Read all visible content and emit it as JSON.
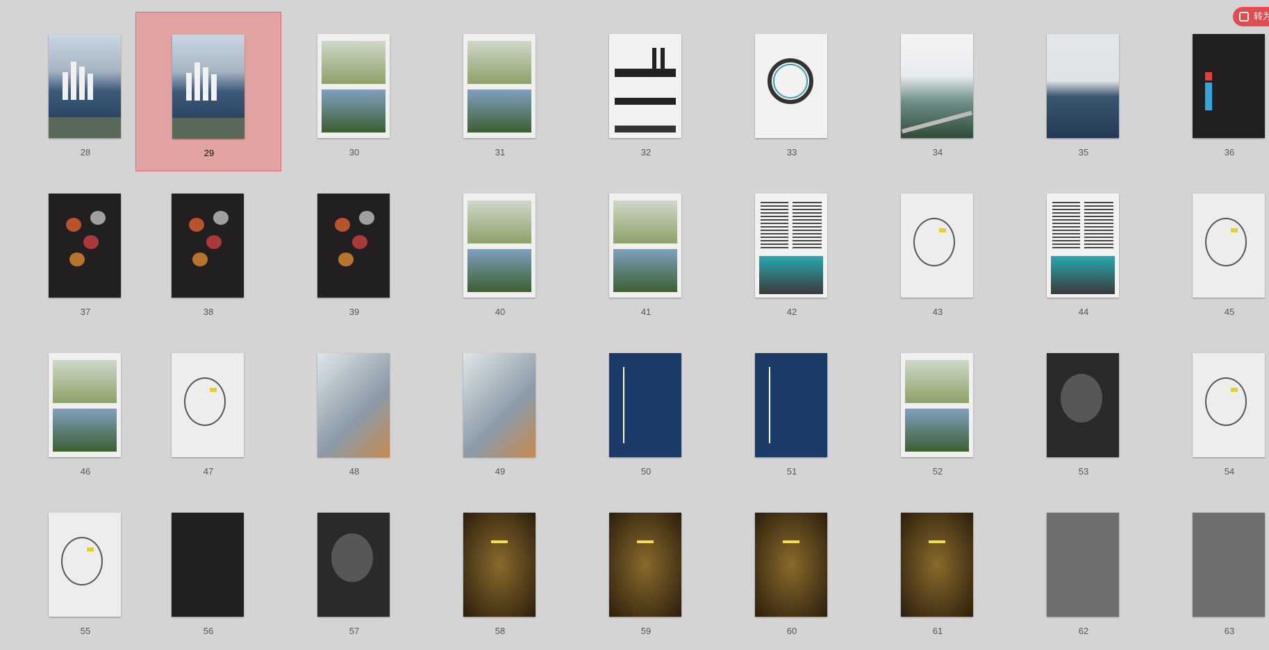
{
  "toolbar": {
    "convert_label": "转为",
    "convert_icon": "convert-icon"
  },
  "selected_page": "29",
  "pages": [
    {
      "label": "28",
      "art": "photo"
    },
    {
      "label": "29",
      "art": "photo"
    },
    {
      "label": "30",
      "art": "two"
    },
    {
      "label": "31",
      "art": "two"
    },
    {
      "label": "32",
      "art": "diagram"
    },
    {
      "label": "33",
      "art": "ring"
    },
    {
      "label": "34",
      "art": "bridge"
    },
    {
      "label": "35",
      "art": "river"
    },
    {
      "label": "36",
      "art": "darktext"
    },
    {
      "label": "37",
      "art": "darkmap"
    },
    {
      "label": "38",
      "art": "darkmap"
    },
    {
      "label": "39",
      "art": "darkmap"
    },
    {
      "label": "40",
      "art": "two"
    },
    {
      "label": "41",
      "art": "two"
    },
    {
      "label": "42",
      "art": "text"
    },
    {
      "label": "43",
      "art": "map"
    },
    {
      "label": "44",
      "art": "text"
    },
    {
      "label": "45",
      "art": "map"
    },
    {
      "label": "46",
      "art": "two"
    },
    {
      "label": "47",
      "art": "map"
    },
    {
      "label": "48",
      "art": "aerial"
    },
    {
      "label": "49",
      "art": "aerial"
    },
    {
      "label": "50",
      "art": "blue"
    },
    {
      "label": "51",
      "art": "blue"
    },
    {
      "label": "52",
      "art": "two"
    },
    {
      "label": "53",
      "art": "bw"
    },
    {
      "label": "54",
      "art": "map"
    },
    {
      "label": "55",
      "art": "map"
    },
    {
      "label": "56",
      "art": "dark"
    },
    {
      "label": "57",
      "art": "bw"
    },
    {
      "label": "58",
      "art": "night"
    },
    {
      "label": "59",
      "art": "night"
    },
    {
      "label": "60",
      "art": "night"
    },
    {
      "label": "61",
      "art": "night"
    },
    {
      "label": "62",
      "art": "gray"
    },
    {
      "label": "63",
      "art": "gray"
    }
  ]
}
